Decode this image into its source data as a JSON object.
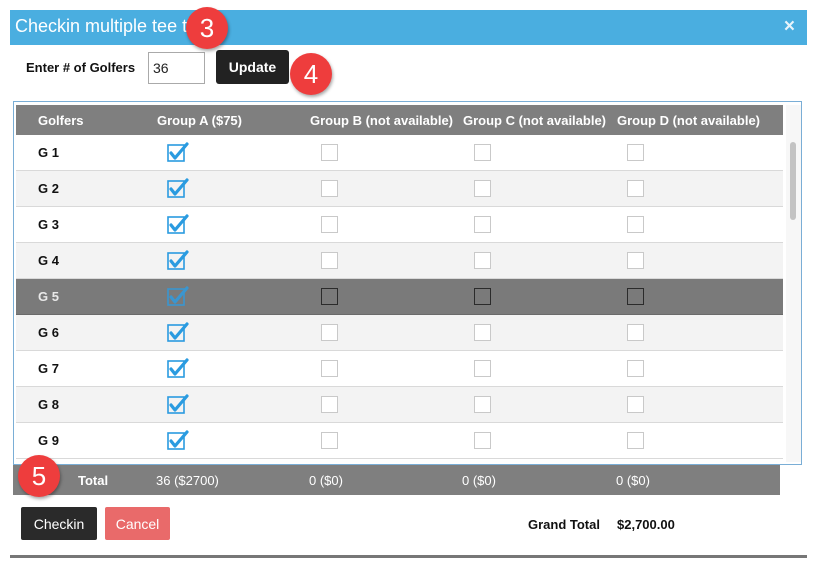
{
  "dialog": {
    "title": "Checkin multiple tee times",
    "close_symbol": "×"
  },
  "golfers": {
    "label": "Enter # of Golfers",
    "value": "36"
  },
  "update_label": "Update",
  "table": {
    "headers": [
      "Golfers",
      "Group A ($75)",
      "Group B (not available)",
      "Group C (not available)",
      "Group D (not available)"
    ],
    "rows": [
      {
        "label": "G 1",
        "group_a": true,
        "group_b": false,
        "group_c": false,
        "group_d": false
      },
      {
        "label": "G 2",
        "group_a": true,
        "group_b": false,
        "group_c": false,
        "group_d": false
      },
      {
        "label": "G 3",
        "group_a": true,
        "group_b": false,
        "group_c": false,
        "group_d": false
      },
      {
        "label": "G 4",
        "group_a": true,
        "group_b": false,
        "group_c": false,
        "group_d": false
      },
      {
        "label": "G 5",
        "group_a": true,
        "group_b": false,
        "group_c": false,
        "group_d": false,
        "selected": true
      },
      {
        "label": "G 6",
        "group_a": true,
        "group_b": false,
        "group_c": false,
        "group_d": false
      },
      {
        "label": "G 7",
        "group_a": true,
        "group_b": false,
        "group_c": false,
        "group_d": false
      },
      {
        "label": "G 8",
        "group_a": true,
        "group_b": false,
        "group_c": false,
        "group_d": false
      },
      {
        "label": "G 9",
        "group_a": true,
        "group_b": false,
        "group_c": false,
        "group_d": false
      }
    ],
    "totals": {
      "label": "Total",
      "group_a": "36 ($2700)",
      "group_b": "0 ($0)",
      "group_c": "0 ($0)",
      "group_d": "0 ($0)"
    }
  },
  "actions": {
    "checkin_label": "Checkin",
    "cancel_label": "Cancel"
  },
  "grand_total": {
    "label": "Grand Total",
    "value": "$2,700.00"
  },
  "callouts": [
    "3",
    "4",
    "5"
  ],
  "colors": {
    "titlebar": "#4aaee0",
    "header_bg": "#7f7f7f",
    "check": "#2a9be0",
    "cancel": "#e96a6a",
    "badge": "#ee3d3d"
  }
}
